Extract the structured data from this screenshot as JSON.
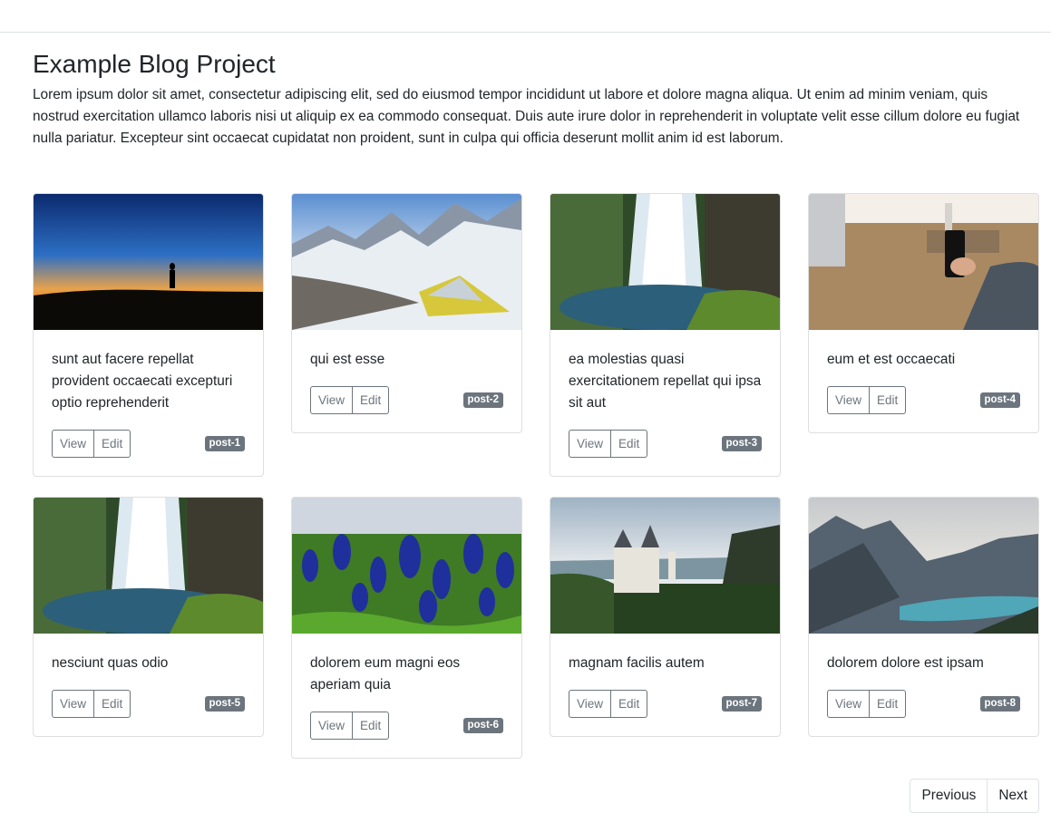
{
  "header": {
    "title": "Example Blog Project",
    "description": "Lorem ipsum dolor sit amet, consectetur adipiscing elit, sed do eiusmod tempor incididunt ut labore et dolore magna aliqua. Ut enim ad minim veniam, quis nostrud exercitation ullamco laboris nisi ut aliquip ex ea commodo consequat. Duis aute irure dolor in reprehenderit in voluptate velit esse cillum dolore eu fugiat nulla pariatur. Excepteur sint occaecat cupidatat non proident, sunt in culpa qui officia deserunt mollit anim id est laborum."
  },
  "posts": [
    {
      "title": "sunt aut facere repellat provident occaecati excepturi optio reprehenderit",
      "badge": "post-1",
      "image": "sunset-silhouette",
      "view_label": "View",
      "edit_label": "Edit"
    },
    {
      "title": "qui est esse",
      "badge": "post-2",
      "image": "snowy-mountain-camp",
      "view_label": "View",
      "edit_label": "Edit"
    },
    {
      "title": "ea molestias quasi exercitationem repellat qui ipsa sit aut",
      "badge": "post-3",
      "image": "waterfall",
      "view_label": "View",
      "edit_label": "Edit"
    },
    {
      "title": "eum et est occaecati",
      "badge": "post-4",
      "image": "desk-phone",
      "view_label": "View",
      "edit_label": "Edit"
    },
    {
      "title": "nesciunt quas odio",
      "badge": "post-5",
      "image": "waterfall",
      "view_label": "View",
      "edit_label": "Edit"
    },
    {
      "title": "dolorem eum magni eos aperiam quia",
      "badge": "post-6",
      "image": "bluebonnets",
      "view_label": "View",
      "edit_label": "Edit"
    },
    {
      "title": "magnam facilis autem",
      "badge": "post-7",
      "image": "castle-forest",
      "view_label": "View",
      "edit_label": "Edit"
    },
    {
      "title": "dolorem dolore est ipsam",
      "badge": "post-8",
      "image": "mountain-lake",
      "view_label": "View",
      "edit_label": "Edit"
    }
  ],
  "pagination": {
    "previous_label": "Previous",
    "next_label": "Next"
  }
}
